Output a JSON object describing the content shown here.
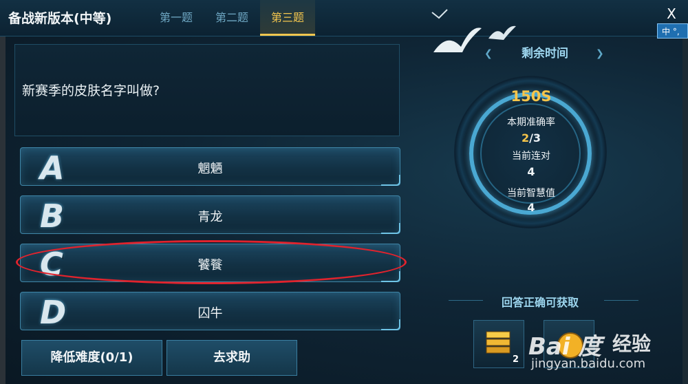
{
  "header": {
    "title": "备战新版本(中等)",
    "tabs": [
      {
        "label": "第一题",
        "active": false
      },
      {
        "label": "第二题",
        "active": false
      },
      {
        "label": "第三题",
        "active": true
      }
    ],
    "close_label": "X",
    "ime_label": "中 °,"
  },
  "question": {
    "text": "新赛季的皮肤名字叫做?"
  },
  "options": [
    {
      "letter": "A",
      "label": "魍魉"
    },
    {
      "letter": "B",
      "label": "青龙"
    },
    {
      "letter": "C",
      "label": "饕餮"
    },
    {
      "letter": "D",
      "label": "囚牛"
    }
  ],
  "buttons": {
    "lower_difficulty": "降低难度(0/1)",
    "ask_help": "去求助"
  },
  "stats": {
    "time_header": "剩余时间",
    "timer": "150S",
    "accuracy_label": "本期准确率",
    "accuracy_correct": "2",
    "accuracy_total": "/3",
    "streak_label": "当前连对",
    "streak_value": "4",
    "wisdom_label": "当前智慧值",
    "wisdom_value": "4"
  },
  "reward": {
    "title": "回答正确可获取",
    "count": "2"
  },
  "watermark": {
    "logo": "Bai 度",
    "text": "经验",
    "url": "jingyan.baidu.com"
  },
  "colors": {
    "accent": "#f4c64e",
    "ring": "#4aa8d2",
    "annotation": "#e0232d"
  }
}
